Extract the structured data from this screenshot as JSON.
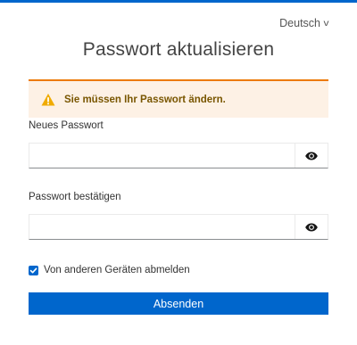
{
  "language": {
    "label": "Deutsch",
    "chevron": "chevron-down-icon"
  },
  "page": {
    "title": "Passwort aktualisieren"
  },
  "alert": {
    "icon": "warning-icon",
    "message": "Sie müssen Ihr Passwort ändern.",
    "accent": "#ec7a08",
    "background": "#fdf1e5",
    "text_color": "#795600"
  },
  "fields": {
    "new_password": {
      "label": "Neues Passwort",
      "value": "",
      "icon": "eye-icon"
    },
    "confirm_password": {
      "label": "Passwort bestätigen",
      "value": "",
      "icon": "eye-icon"
    }
  },
  "logout_other_devices": {
    "label": "Von anderen Geräten abmelden",
    "checked": true
  },
  "submit": {
    "label": "Absenden"
  },
  "colors": {
    "primary": "#0066cc"
  }
}
